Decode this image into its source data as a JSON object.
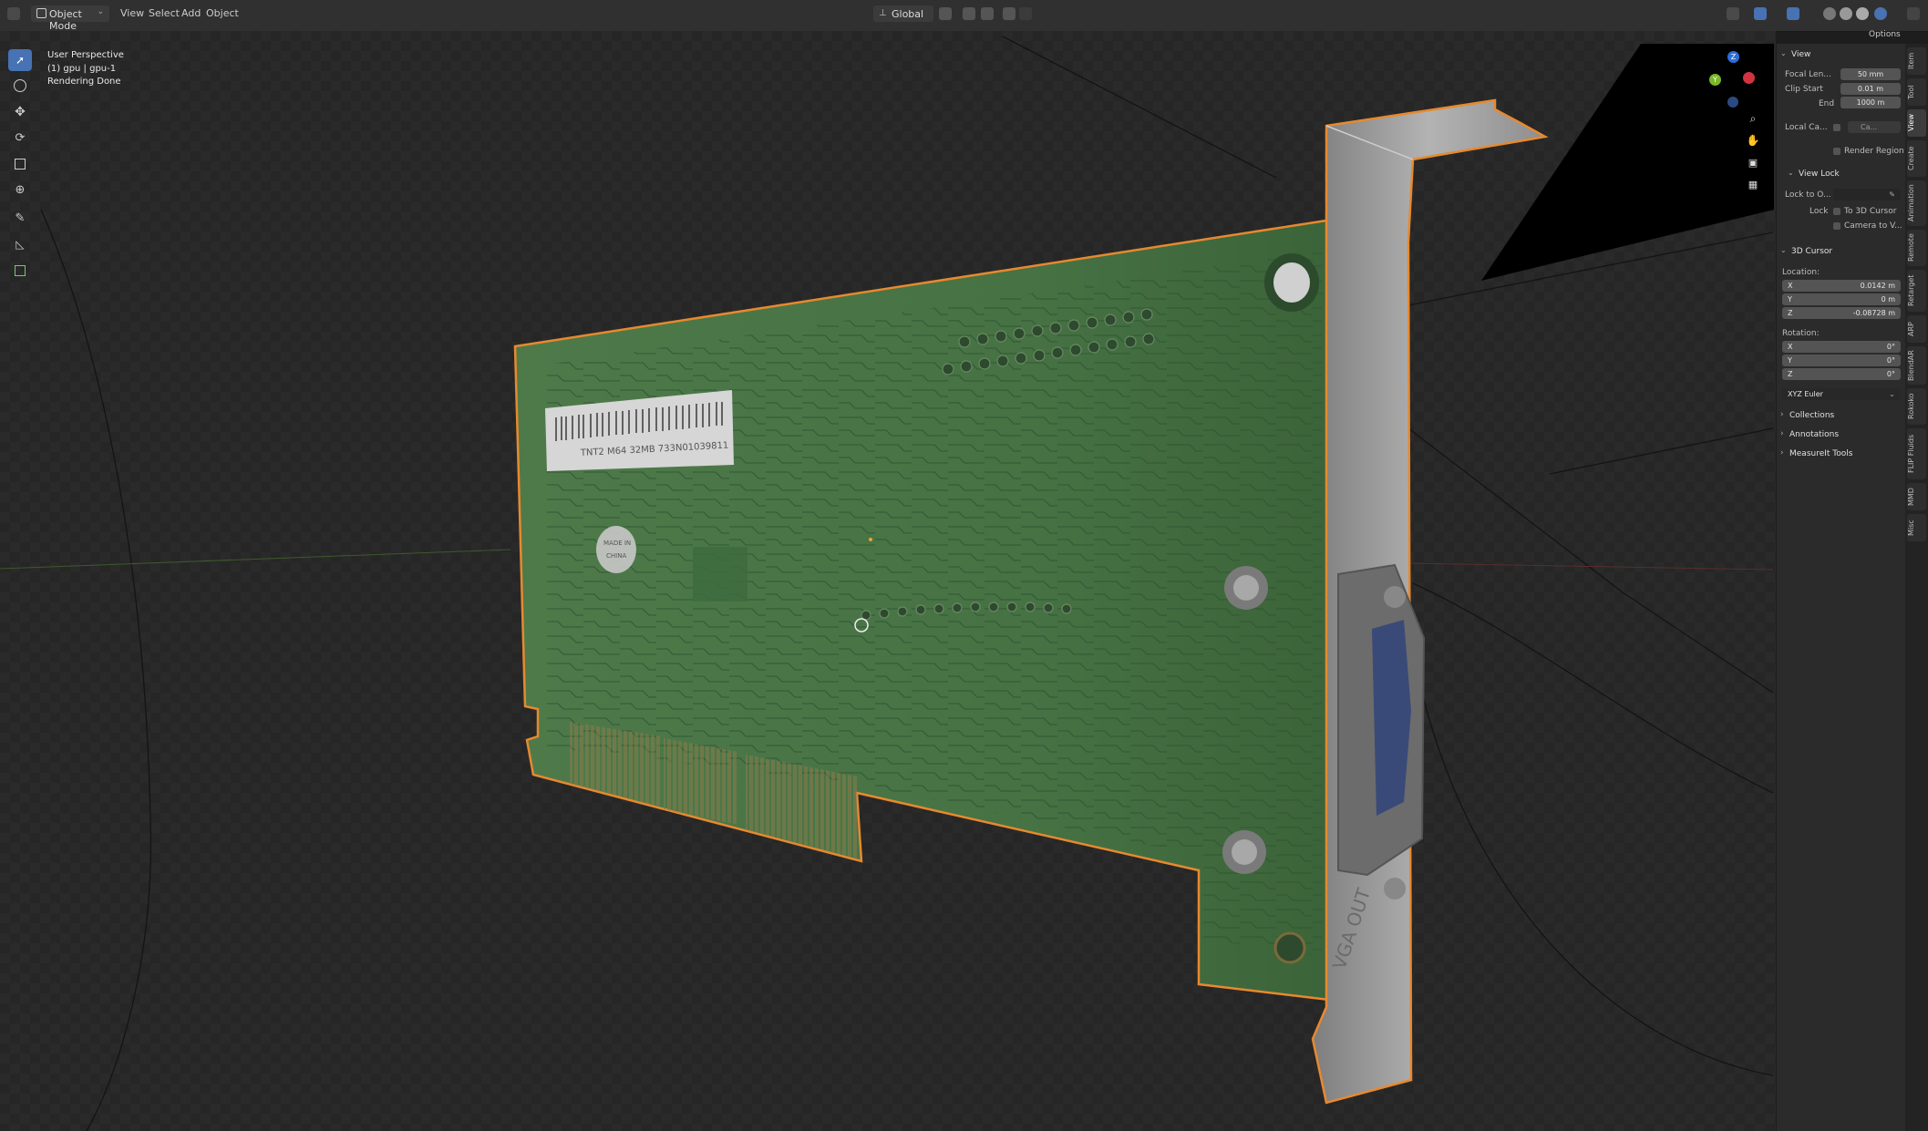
{
  "header": {
    "mode": "Object Mode",
    "menus": [
      "View",
      "Select",
      "Add",
      "Object"
    ],
    "transform_orientation": "Global",
    "options_label": "Options"
  },
  "viewport": {
    "info": [
      "User Perspective",
      "(1) gpu | gpu-1",
      "Rendering Done"
    ]
  },
  "gizmo": {
    "z": "Z",
    "y": "Y"
  },
  "card": {
    "barcode_text": "TNT2 M64 32MB 733N01039811",
    "stamp_line1": "MADE IN",
    "stamp_line2": "CHINA",
    "bracket_text": "VGA OUT"
  },
  "npanel": {
    "view_section": "View",
    "focal_label": "Focal Len...",
    "focal_value": "50 mm",
    "clip_start_label": "Clip Start",
    "clip_start_value": "0.01 m",
    "end_label": "End",
    "end_value": "1000 m",
    "local_cam_label": "Local Ca...",
    "local_cam_value": "Ca...",
    "render_region": "Render Region",
    "view_lock_section": "View Lock",
    "lock_to_label": "Lock to O...",
    "lock_label": "Lock",
    "to_cursor": "To 3D Cursor",
    "camera_to_view": "Camera to V...",
    "cursor_section": "3D Cursor",
    "location_label": "Location:",
    "loc": [
      {
        "axis": "X",
        "value": "0.0142 m"
      },
      {
        "axis": "Y",
        "value": "0 m"
      },
      {
        "axis": "Z",
        "value": "-0.08728 m"
      }
    ],
    "rotation_label": "Rotation:",
    "rot": [
      {
        "axis": "X",
        "value": "0°"
      },
      {
        "axis": "Y",
        "value": "0°"
      },
      {
        "axis": "Z",
        "value": "0°"
      }
    ],
    "rotation_mode": "XYZ Euler",
    "collections": "Collections",
    "annotations": "Annotations",
    "measureit": "MeasureIt Tools"
  },
  "tabs": [
    "Item",
    "Tool",
    "View",
    "Create",
    "Animation",
    "Remote",
    "Retarget",
    "ARP",
    "BlendAR",
    "Rokoko",
    "FLIP Fluids",
    "MMD",
    "Misc"
  ]
}
